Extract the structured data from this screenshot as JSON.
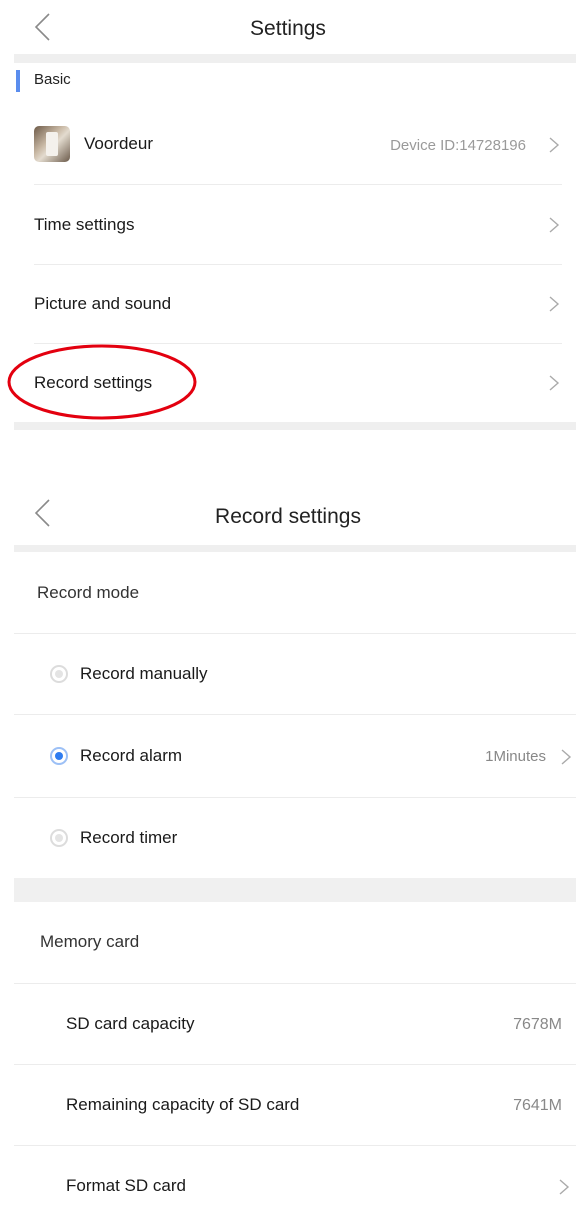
{
  "settings_screen": {
    "title": "Settings",
    "section_label": "Basic",
    "device": {
      "name": "Voordeur",
      "device_id": "Device ID:14728196"
    },
    "items": [
      {
        "label": "Time settings"
      },
      {
        "label": "Picture and sound"
      },
      {
        "label": "Record settings",
        "highlighted": true
      }
    ]
  },
  "record_settings_screen": {
    "title": "Record settings",
    "record_mode": {
      "heading": "Record mode",
      "options": [
        {
          "label": "Record manually",
          "selected": false
        },
        {
          "label": "Record alarm",
          "selected": true,
          "value": "1Minutes"
        },
        {
          "label": "Record timer",
          "selected": false
        }
      ]
    },
    "memory_card": {
      "heading": "Memory card",
      "sd_capacity": {
        "label": "SD card capacity",
        "value": "7678M"
      },
      "remaining": {
        "label": "Remaining capacity of SD card",
        "value": "7641M"
      },
      "format": {
        "label": "Format SD card"
      }
    }
  },
  "colors": {
    "accent": "#5a8dee",
    "radio_selected": "#2f7cf0",
    "annotation": "#e3000f",
    "divider": "#ececec",
    "secondary_text": "#9a9a9a"
  },
  "icons": [
    "back-chevron-icon",
    "chevron-right-icon",
    "radio-icon"
  ]
}
